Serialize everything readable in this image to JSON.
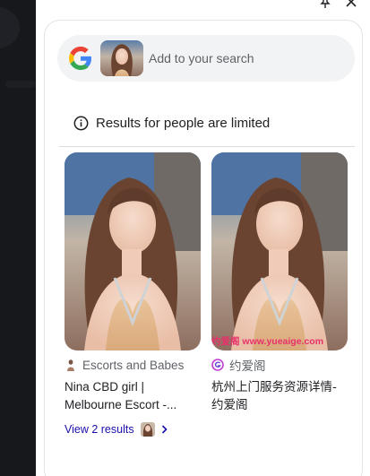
{
  "colors": {
    "panel_background": "#ffffff",
    "search_pill": "#f1f3f4",
    "link_blue": "#1a0dab",
    "secondary_text": "#5f6368",
    "left_dark_area": "#17181c"
  },
  "header": {
    "pin_icon": "pin-icon",
    "close_icon": "close-icon"
  },
  "search": {
    "logo_icon": "google-g-logo",
    "placeholder": "Add to your search",
    "value": ""
  },
  "notice": {
    "icon": "info-icon",
    "text": "Results for people are limited"
  },
  "results": [
    {
      "source": "Escorts and Babes",
      "title": "Nina CBD girl | Melbourne Escort -...",
      "more_label": "View 2 results"
    },
    {
      "source": "约爱阁",
      "title": "杭州上门服务资源详情-约爱阁",
      "watermark": "约爱阁 www.yueaige.com"
    }
  ]
}
